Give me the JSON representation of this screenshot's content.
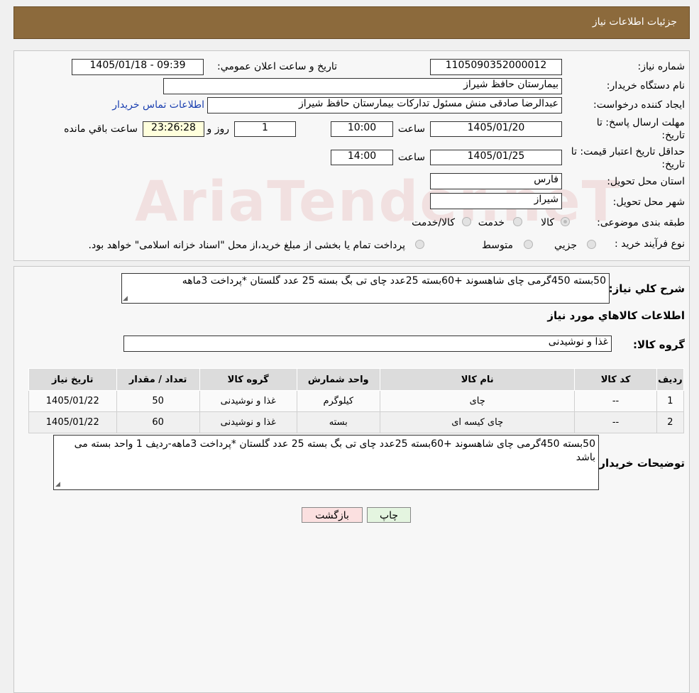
{
  "header": {
    "title": "جزئیات اطلاعات نیاز"
  },
  "form": {
    "need_number_label": "شماره نیاز:",
    "need_number": "1105090352000012",
    "announce_label": "تاريخ و ساعت اعلان عمومي:",
    "announce_value": "1405/01/18 - 09:39",
    "buyer_label": "نام دستگاه خريدار:",
    "buyer_value": "بیمارستان حافظ شیراز",
    "creator_label": "ايجاد کننده درخواست:",
    "creator_value": "عبدالرضا صادقی منش مسئول تدارکات بیمارستان حافظ شیراز",
    "contact_link": "اطلاعات تماس خريدار",
    "deadline_label_1": "مهلت ارسال پاسخ: تا",
    "deadline_label_2": "تاريخ:",
    "deadline_date": "1405/01/20",
    "time_label": "ساعت",
    "deadline_time": "10:00",
    "days_value": "1",
    "days_label": "روز و",
    "remaining_value": "23:26:28",
    "remaining_label": "ساعت باقي مانده",
    "validity_label_1": "حداقل تاريخ اعتبار قيمت: تا",
    "validity_label_2": "تاريخ:",
    "validity_date": "1405/01/25",
    "validity_time": "14:00",
    "province_label": "استان محل تحويل:",
    "province_value": "فارس",
    "city_label": "شهر محل تحويل:",
    "city_value": "شیراز",
    "category_label": "طبقه بندی موضوعی:",
    "category_options": [
      "کالا",
      "خدمت",
      "کالا/خدمت"
    ],
    "process_label": "نوع فرآيند خريد :",
    "process_options": [
      "جزيي",
      "متوسط"
    ],
    "process_note": "پرداخت تمام یا بخشی از مبلغ خرید،از محل \"اسناد خزانه اسلامی\" خواهد بود."
  },
  "description": {
    "label": "شرح کلي نياز:",
    "value": "50بسته 450گرمی چای شاهسوند +60بسته 25عدد چای تی بگ بسته 25 عدد گلستان *پرداخت 3ماهه"
  },
  "goods": {
    "section_title": "اطلاعات کالاهاي مورد نياز",
    "group_label": "گروه کالا:",
    "group_value": "غذا و نوشیدنی",
    "columns": [
      "رديف",
      "کد کالا",
      "نام کالا",
      "واحد شمارش",
      "گروه کالا",
      "تعداد / مقدار",
      "تاريخ نياز"
    ],
    "rows": [
      [
        "1",
        "--",
        "چای",
        "کیلوگرم",
        "غذا و نوشیدنی",
        "50",
        "1405/01/22"
      ],
      [
        "2",
        "--",
        "چای کیسه ای",
        "بسته",
        "غذا و نوشیدنی",
        "60",
        "1405/01/22"
      ]
    ]
  },
  "buyer_notes": {
    "label": "توضيحات خريدار:",
    "value": "50بسته 450گرمی چای شاهسوند +60بسته 25عدد چای تی بگ بسته 25 عدد گلستان *پرداخت 3ماهه-ردیف 1 واحد بسته می باشد"
  },
  "buttons": {
    "print": "چاپ",
    "back": "بازگشت"
  },
  "watermark": "AriaTender.neT"
}
